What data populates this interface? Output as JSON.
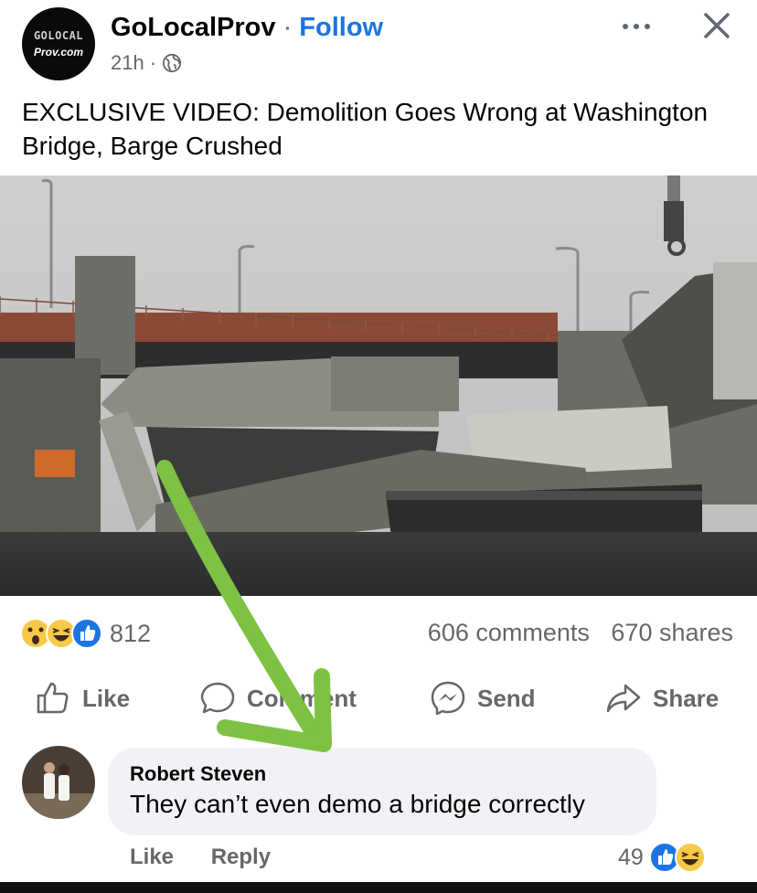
{
  "post": {
    "page_name": "GoLocalProv",
    "separator": "·",
    "follow_label": "Follow",
    "time": "21h",
    "time_sep": "·",
    "logo_top": "GOLOCAL",
    "logo_bottom": "Prov.com",
    "headline": "EXCLUSIVE VIDEO: Demolition Goes Wrong at Washington Bridge, Barge Crushed",
    "privacy_icon": "globe-icon",
    "more_icon": "more-options-icon",
    "close_icon": "close-icon"
  },
  "stats": {
    "reaction_icons": [
      "wow-emoji-icon",
      "haha-emoji-icon",
      "like-reaction-icon"
    ],
    "reaction_count": "812",
    "comments": "606 comments",
    "shares": "670 shares"
  },
  "actions": {
    "like": "Like",
    "comment": "Comment",
    "send": "Send",
    "share": "Share"
  },
  "comment": {
    "author": "Robert Steven",
    "text": "They can’t even demo a bridge correctly",
    "like_label": "Like",
    "reply_label": "Reply",
    "reaction_count": "49",
    "reaction_icons": [
      "like-reaction-icon",
      "haha-emoji-icon"
    ]
  },
  "colors": {
    "accent": "#1b74e4",
    "secondary_text": "#65676b",
    "bubble": "#f0f2f5",
    "annotation": "#7dc242"
  }
}
